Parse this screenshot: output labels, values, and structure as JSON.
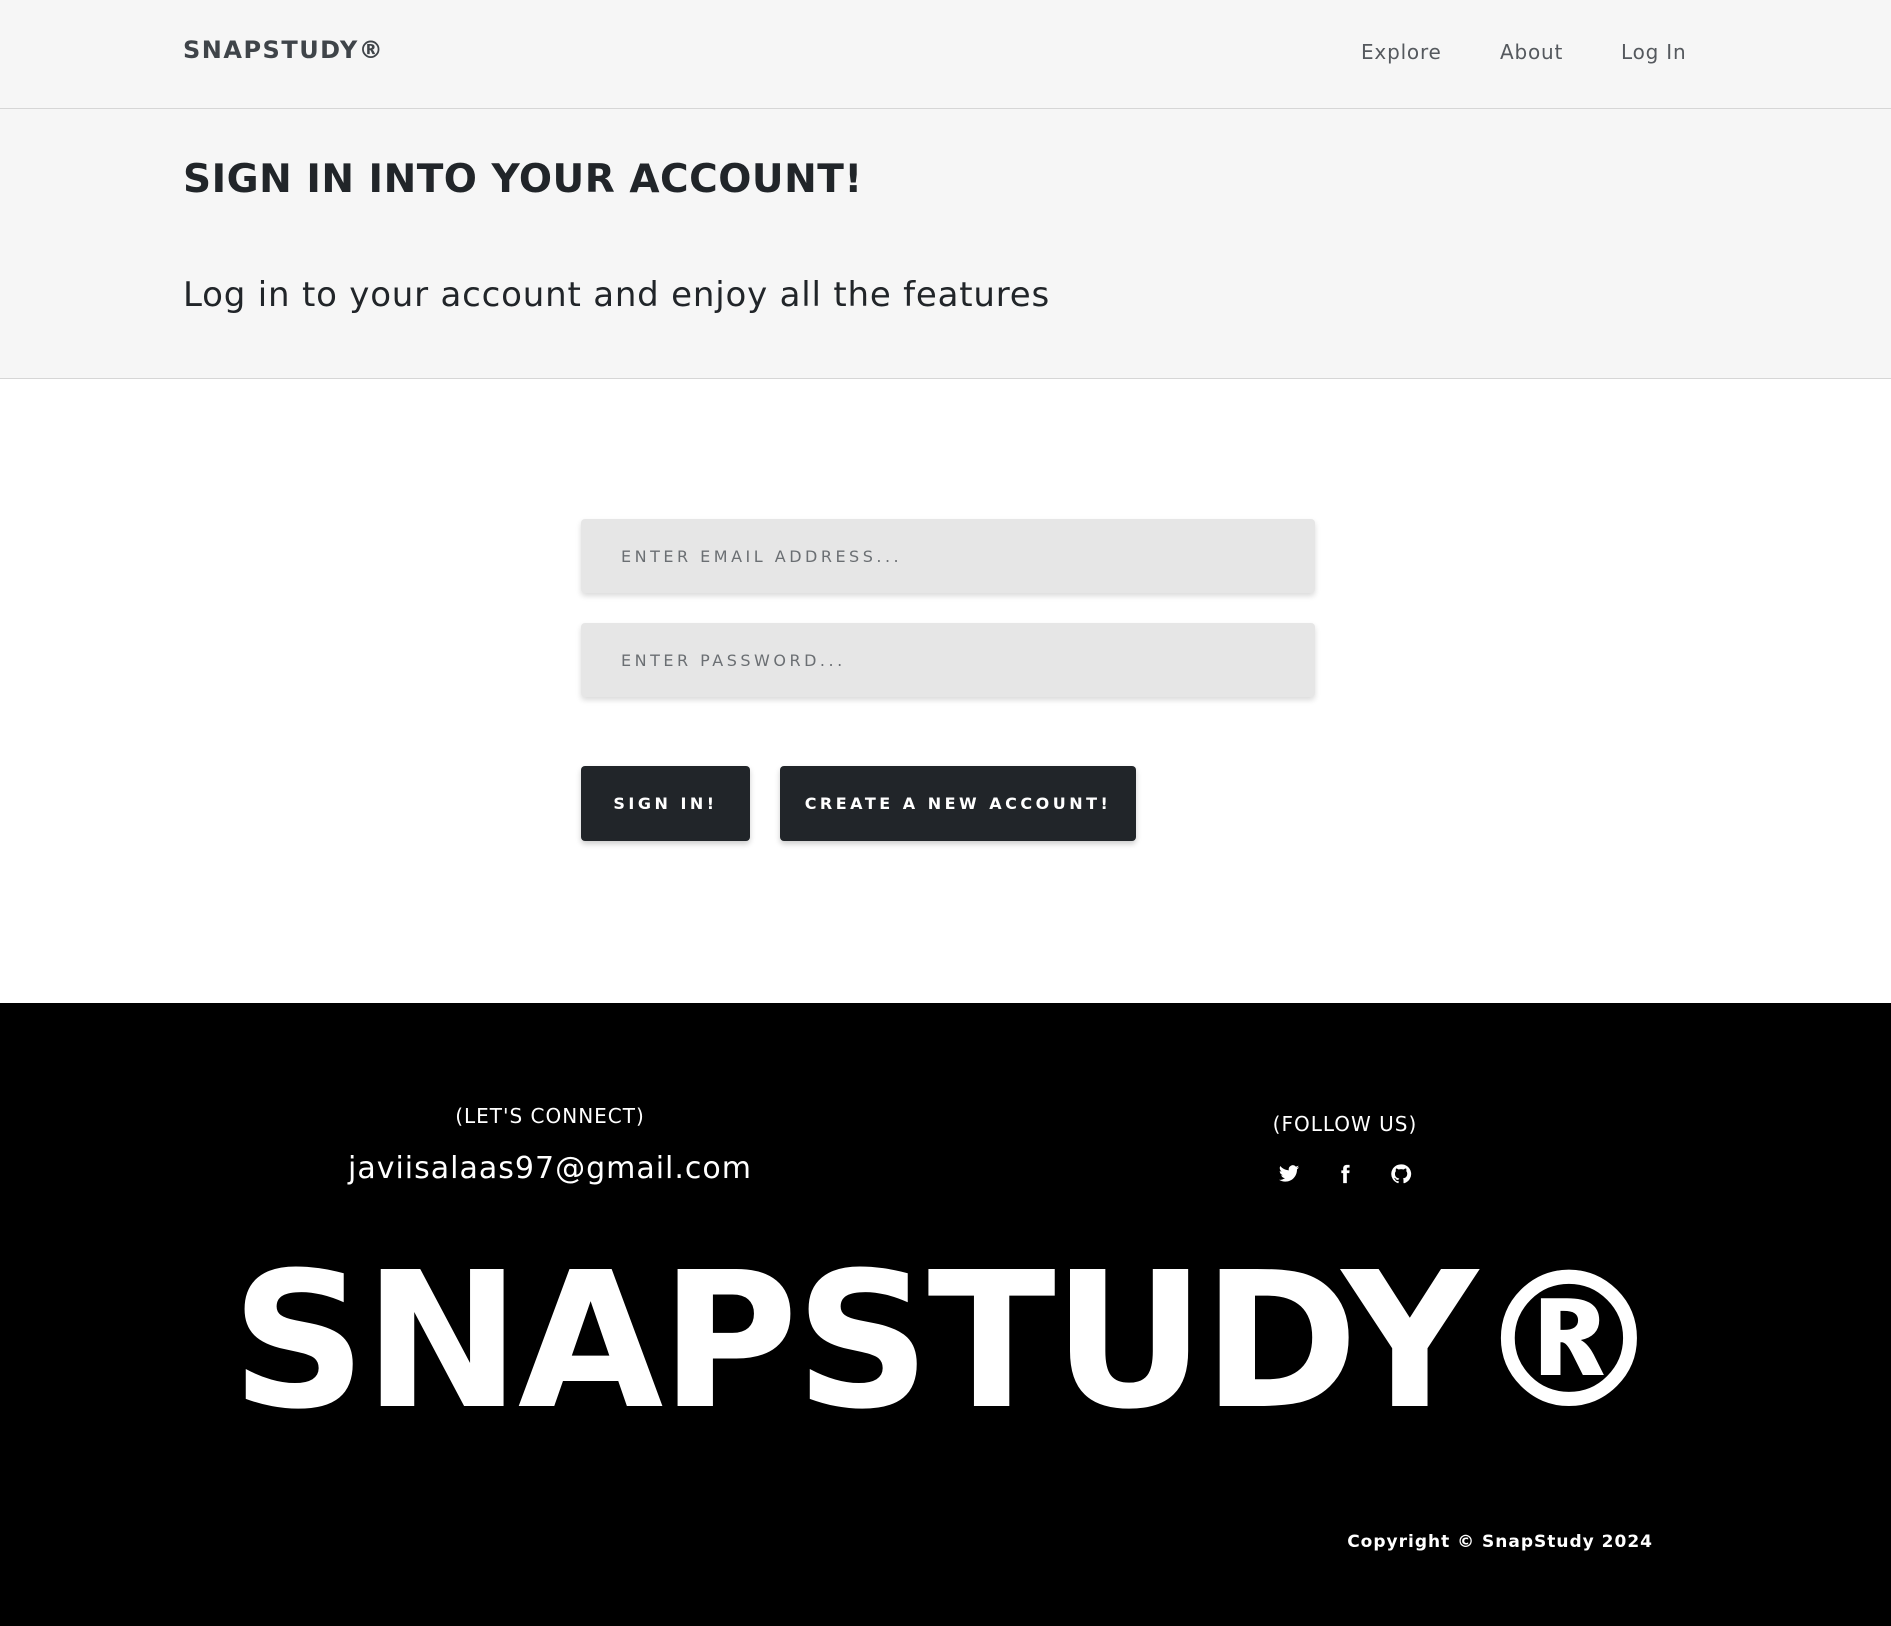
{
  "navbar": {
    "brand": "SNAPSTUDY®",
    "links": [
      "Explore",
      "About",
      "Log In"
    ]
  },
  "header": {
    "title": "SIGN IN INTO YOUR ACCOUNT!",
    "subtitle": "Log in to your account and enjoy all the features"
  },
  "form": {
    "email_placeholder": "ENTER EMAIL ADDRESS...",
    "email_value": "",
    "password_placeholder": "ENTER PASSWORD...",
    "password_value": "",
    "signin_label": "SIGN IN!",
    "create_label": "CREATE A NEW ACCOUNT!"
  },
  "footer": {
    "connect_title": "(LET'S CONNECT)",
    "email": "javiisalaas97@gmail.com",
    "follow_title": "(FOLLOW US)",
    "social_icons": [
      "twitter-icon",
      "facebook-icon",
      "github-icon"
    ],
    "big_logo": "SNAPSTUDY®",
    "copyright": "Copyright © SnapStudy 2024"
  },
  "colors": {
    "nav_bg": "#f6f6f6",
    "button_bg": "#212529",
    "input_bg": "#e6e6e6",
    "footer_bg": "#000000"
  }
}
